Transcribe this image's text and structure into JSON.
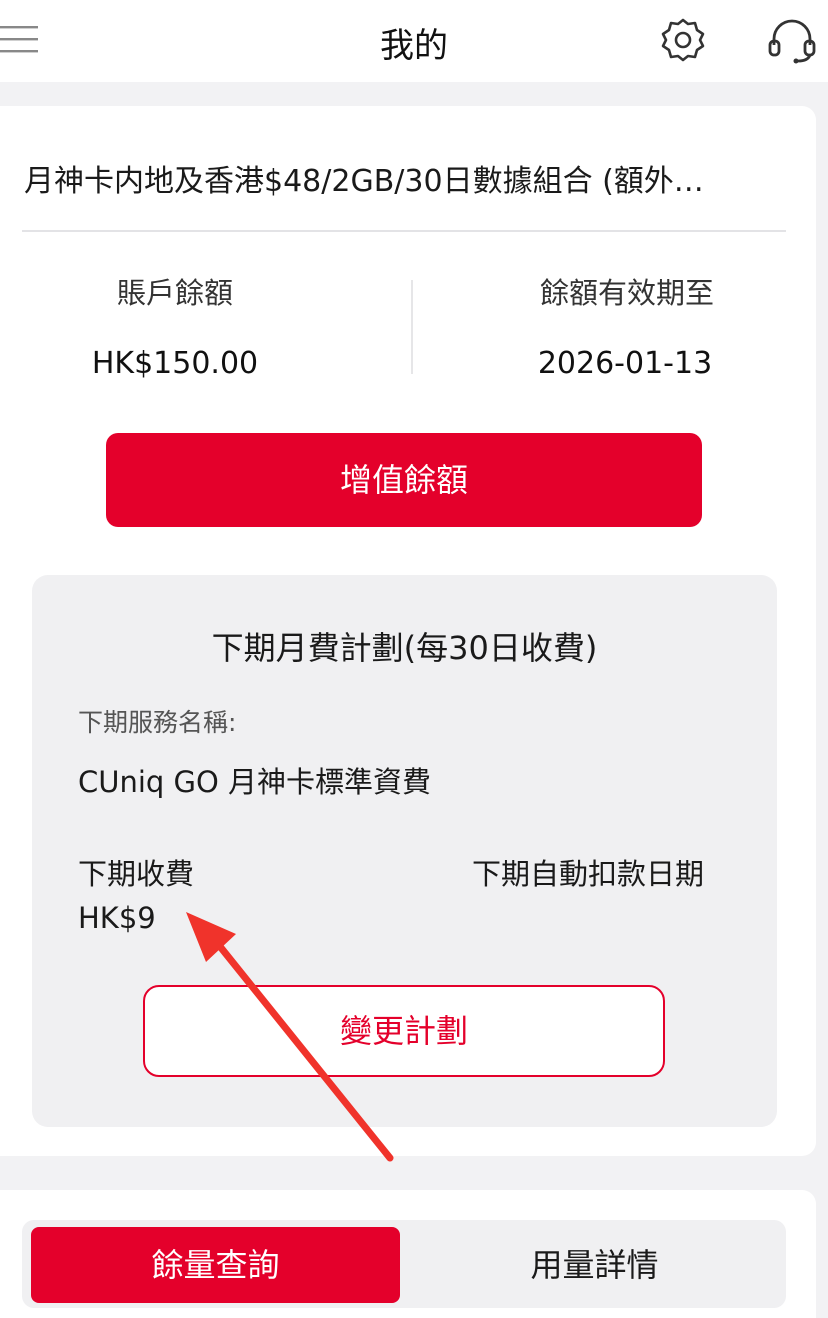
{
  "header": {
    "title": "我的",
    "icons": {
      "menu": "menu-icon",
      "settings": "gear-icon",
      "support": "headset-icon"
    }
  },
  "account": {
    "plan_name": "月神卡内地及香港$48/2GB/30日數據組合 (額外…",
    "balance_label": "賬戶餘額",
    "balance_value": "HK$150.00",
    "expiry_label": "餘額有效期至",
    "expiry_value": "2026-01-13",
    "topup_label": "增值餘額"
  },
  "next_period": {
    "title": "下期月費計劃(每30日收費)",
    "service_label": "下期服務名稱:",
    "service_value": "CUniq GO 月神卡標準資費",
    "fee_label": "下期收費",
    "fee_value": "HK$9",
    "debit_date_label": "下期自動扣款日期",
    "change_plan_label": "變更計劃"
  },
  "tabs": [
    {
      "label": "餘量查詢",
      "active": true
    },
    {
      "label": "用量詳情",
      "active": false
    }
  ],
  "colors": {
    "accent": "#e4002b",
    "background": "#f2f2f4",
    "panel": "#f0f0f2",
    "annotation_arrow": "#f0332b"
  }
}
